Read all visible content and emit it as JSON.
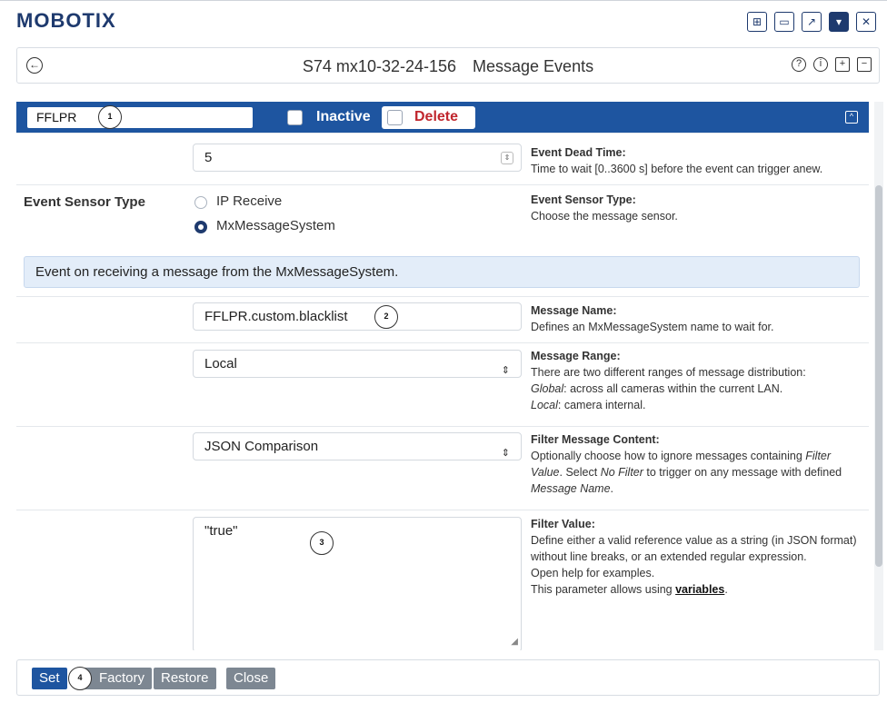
{
  "brand": {
    "logo": "MOBOTIX"
  },
  "window_buttons": [
    "grid-icon",
    "layout-icon",
    "popout-icon",
    "dropdown-icon",
    "close-icon"
  ],
  "title_bar": {
    "camera": "S74 mx10-32-24-156",
    "page": "Message Events"
  },
  "profile": {
    "name": "FFLPR",
    "inactive_label": "Inactive",
    "delete_label": "Delete"
  },
  "dead_time": {
    "value": "5",
    "help_title": "Event Dead Time",
    "help_text": "Time to wait [0..3600 s] before the event can trigger anew."
  },
  "sensor_type": {
    "label": "Event Sensor Type",
    "options": [
      "IP Receive",
      "MxMessageSystem"
    ],
    "selected": "MxMessageSystem",
    "help_title": "Event Sensor Type",
    "help_text": "Choose the message sensor."
  },
  "info_text": "Event on receiving a message from the MxMessageSystem.",
  "message_name": {
    "value": "FFLPR.custom.blacklist",
    "help_title": "Message Name",
    "help_text": "Defines an MxMessageSystem name to wait for."
  },
  "message_range": {
    "value": "Local",
    "help_title": "Message Range",
    "help_line1": "There are two different ranges of message distribution:",
    "help_global_term": "Global",
    "help_global_text": ": across all cameras within the current LAN.",
    "help_local_term": "Local",
    "help_local_text": ": camera internal."
  },
  "filter_content": {
    "value": "JSON Comparison",
    "help_title": "Filter Message Content",
    "help_a": "Optionally choose how to ignore messages containing ",
    "help_term1": "Filter Value",
    "help_b": ". Select ",
    "help_term2": "No Filter",
    "help_c": " to trigger on any message with defined ",
    "help_term3": "Message Name",
    "help_d": "."
  },
  "filter_value": {
    "value": "\"true\"",
    "help_title": "Filter Value",
    "help_text1": "Define either a valid reference value as a string (in JSON format) without line breaks, or an extended regular expression.",
    "help_text2": "Open help for examples.",
    "help_text3": "This parameter allows using ",
    "help_link": "variables",
    "help_text4": "."
  },
  "badges": [
    "1",
    "2",
    "3",
    "4"
  ],
  "footer": {
    "set": "Set",
    "factory": "Factory",
    "restore": "Restore",
    "close": "Close"
  }
}
